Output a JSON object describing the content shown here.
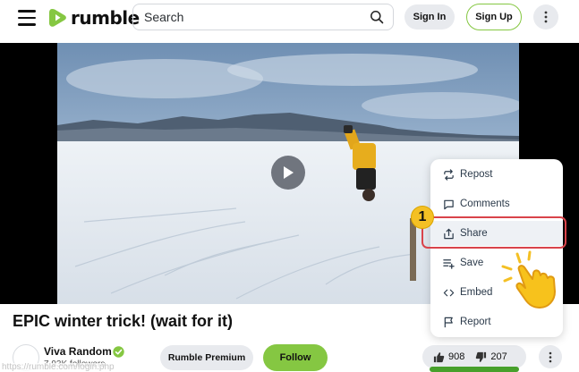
{
  "header": {
    "logo_text": "rumble",
    "search_placeholder": "Search",
    "signin_label": "Sign In",
    "signup_label": "Sign Up"
  },
  "video": {
    "title": "EPIC winter trick! (wait for it)"
  },
  "channel": {
    "name": "Viva Random",
    "followers": "7.93K followers",
    "premium_label": "Rumble Premium",
    "follow_label": "Follow"
  },
  "votes": {
    "likes": "908",
    "dislikes": "207"
  },
  "menu": {
    "items": [
      {
        "label": "Repost",
        "icon": "repost-icon"
      },
      {
        "label": "Comments",
        "icon": "comment-icon"
      },
      {
        "label": "Share",
        "icon": "share-icon"
      },
      {
        "label": "Save",
        "icon": "save-playlist-icon"
      },
      {
        "label": "Embed",
        "icon": "embed-code-icon"
      },
      {
        "label": "Report",
        "icon": "flag-icon"
      }
    ]
  },
  "annotation": {
    "step_number": "1"
  },
  "url_overlay": "https://rumble.com/login.php",
  "colors": {
    "brand_green": "#85c742",
    "highlight_red": "#d9434a",
    "badge_yellow": "#f4c024"
  }
}
